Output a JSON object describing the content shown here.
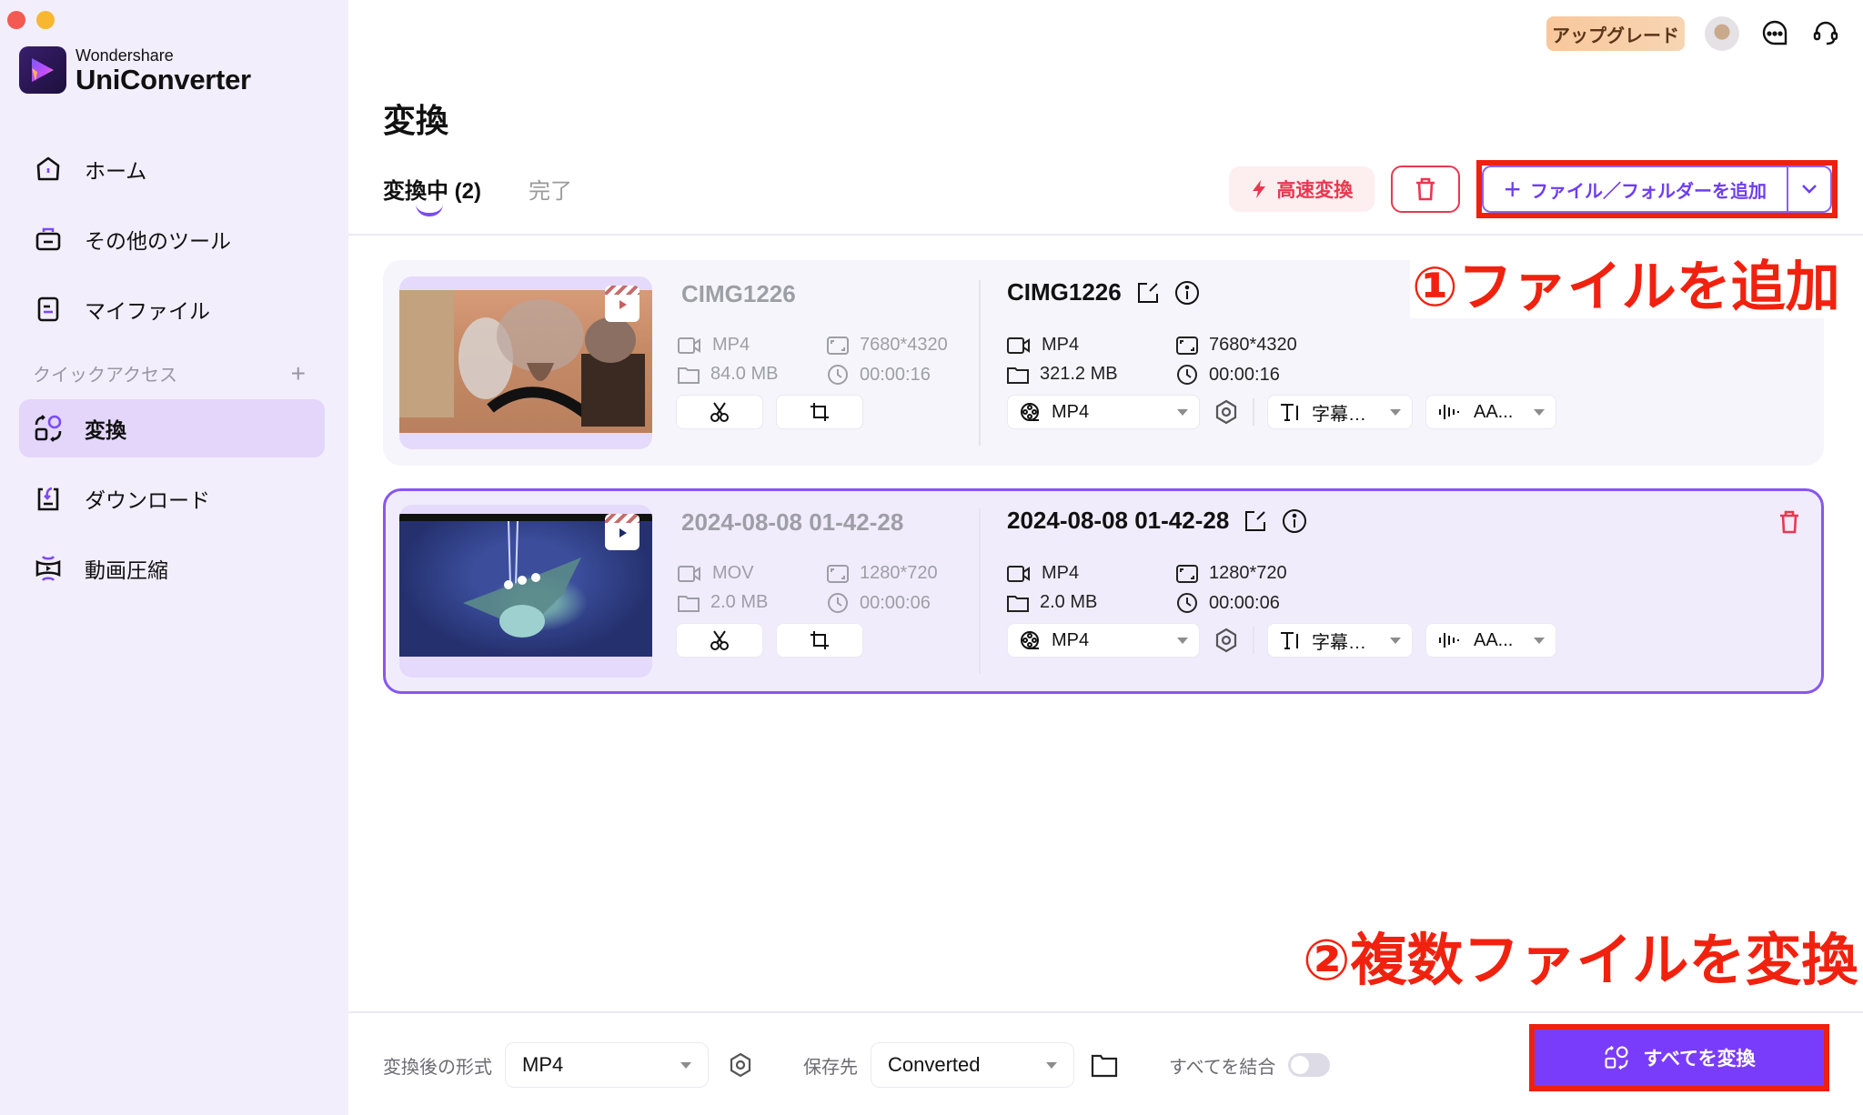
{
  "app": {
    "brand": "Wondershare",
    "product": "UniConverter"
  },
  "sidebar": {
    "items": [
      {
        "label": "ホーム",
        "icon": "home-icon"
      },
      {
        "label": "その他のツール",
        "icon": "toolbox-icon"
      },
      {
        "label": "マイファイル",
        "icon": "file-icon"
      }
    ],
    "quick_access_label": "クイックアクセス",
    "quick_access_add": "+",
    "quick_items": [
      {
        "label": "変換",
        "icon": "convert-icon",
        "active": true
      },
      {
        "label": "ダウンロード",
        "icon": "download-icon",
        "active": false
      },
      {
        "label": "動画圧縮",
        "icon": "compress-icon",
        "active": false
      }
    ]
  },
  "topbar": {
    "upgrade_label": "アップグレード"
  },
  "main": {
    "title": "変換",
    "tabs": [
      {
        "label": "変換中 (2)",
        "active": true
      },
      {
        "label": "完了",
        "active": false
      }
    ],
    "toolbar": {
      "fast_convert_label": "高速変換",
      "add_files_label": "ファイル／フォルダーを追加"
    }
  },
  "files": [
    {
      "source": {
        "name": "CIMG1226",
        "format": "MP4",
        "resolution": "7680*4320",
        "size": "84.0 MB",
        "duration": "00:00:16"
      },
      "output": {
        "name": "CIMG1226",
        "format": "MP4",
        "resolution": "7680*4320",
        "size": "321.2 MB",
        "duration": "00:00:16"
      },
      "format_select": "MP4",
      "subtitle_select": "字幕…",
      "audio_select": "AA...",
      "selected": false
    },
    {
      "source": {
        "name": "2024-08-08 01-42-28",
        "format": "MOV",
        "resolution": "1280*720",
        "size": "2.0 MB",
        "duration": "00:00:06"
      },
      "output": {
        "name": "2024-08-08 01-42-28",
        "format": "MP4",
        "resolution": "1280*720",
        "size": "2.0 MB",
        "duration": "00:00:06"
      },
      "format_select": "MP4",
      "subtitle_select": "字幕…",
      "audio_select": "AA...",
      "selected": true
    }
  ],
  "annotations": {
    "step1": "①ファイルを追加",
    "step2": "②複数ファイルを変換"
  },
  "bottom": {
    "output_format_label": "変換後の形式",
    "output_format_value": "MP4",
    "save_to_label": "保存先",
    "save_to_value": "Converted",
    "merge_label": "すべてを結合",
    "merge_enabled": false,
    "convert_all_label": "すべてを変換"
  },
  "colors": {
    "accent": "#7a3cfb",
    "danger": "#e8384f",
    "annotation": "#f0220f",
    "sidebar_bg": "#f3eefc"
  }
}
